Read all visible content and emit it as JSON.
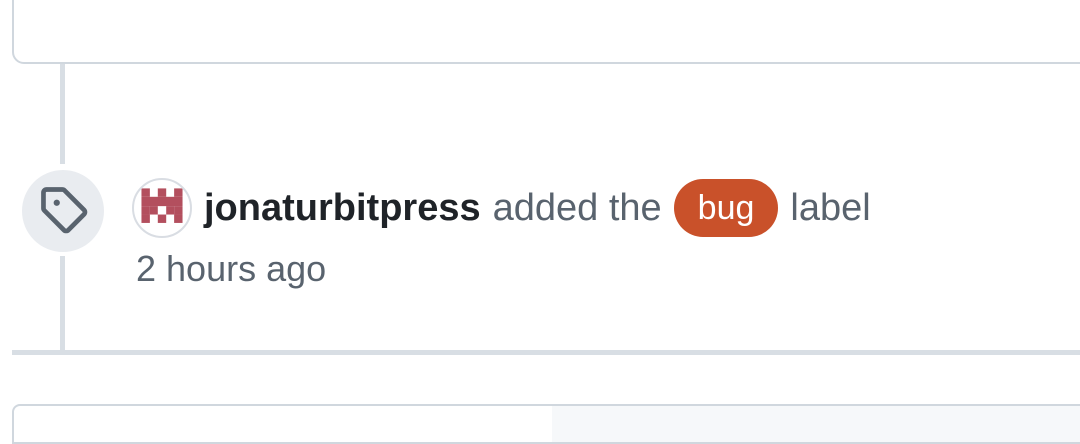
{
  "event": {
    "actor": "jonaturbitpress",
    "action_prefix": "added the",
    "action_suffix": "label",
    "timestamp": "2 hours ago",
    "label": {
      "name": "bug",
      "background": "#c9512a",
      "text_color": "#ffffff"
    },
    "icon": "tag-icon",
    "avatar": "identicon-avatar"
  },
  "colors": {
    "avatar_fill": "#b34f5e",
    "timeline": "#d8dee4",
    "muted_text": "#59636e",
    "primary_text": "#1f2328"
  }
}
